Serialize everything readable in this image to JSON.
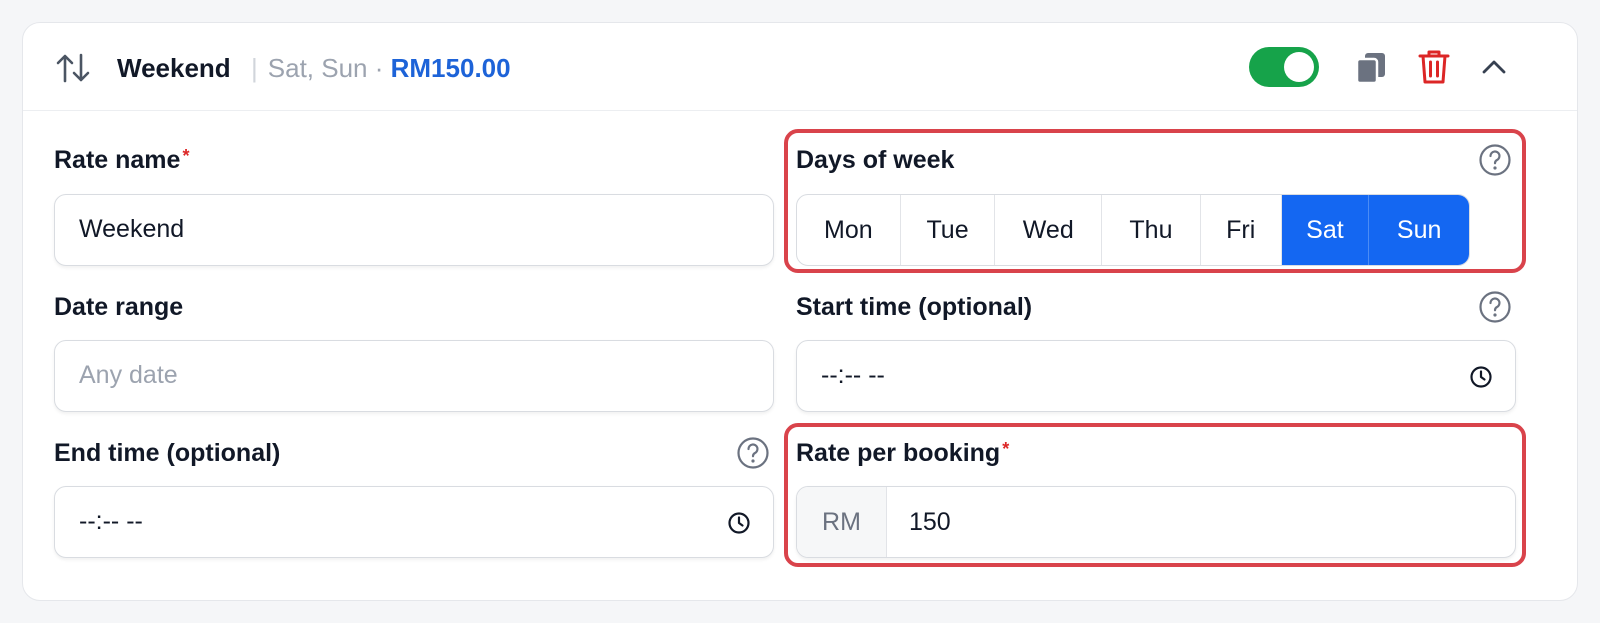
{
  "header": {
    "title": "Weekend",
    "separator": "|",
    "days_summary": "Sat, Sun ·",
    "price": "RM150.00",
    "enabled": true
  },
  "fields": {
    "rate_name": {
      "label": "Rate name",
      "required_mark": "*",
      "value": "Weekend"
    },
    "days_of_week": {
      "label": "Days of week",
      "days": [
        {
          "label": "Mon",
          "selected": false
        },
        {
          "label": "Tue",
          "selected": false
        },
        {
          "label": "Wed",
          "selected": false
        },
        {
          "label": "Thu",
          "selected": false
        },
        {
          "label": "Fri",
          "selected": false
        },
        {
          "label": "Sat",
          "selected": true
        },
        {
          "label": "Sun",
          "selected": true
        }
      ]
    },
    "date_range": {
      "label": "Date range",
      "placeholder": "Any date"
    },
    "start_time": {
      "label": "Start time (optional)",
      "value": "--:-- --"
    },
    "end_time": {
      "label": "End time (optional)",
      "value": "--:-- --"
    },
    "rate_per_booking": {
      "label": "Rate per booking",
      "required_mark": "*",
      "prefix": "RM",
      "value": "150"
    }
  },
  "colors": {
    "accent": "#1467f2",
    "price": "#1d63d8",
    "toggle_on": "#16a34a",
    "delete": "#dc2626",
    "highlight": "#d9434b"
  },
  "icons": [
    "sort-arrows-icon",
    "copy-icon",
    "trash-icon",
    "chevron-up-icon",
    "help-icon",
    "clock-icon"
  ]
}
